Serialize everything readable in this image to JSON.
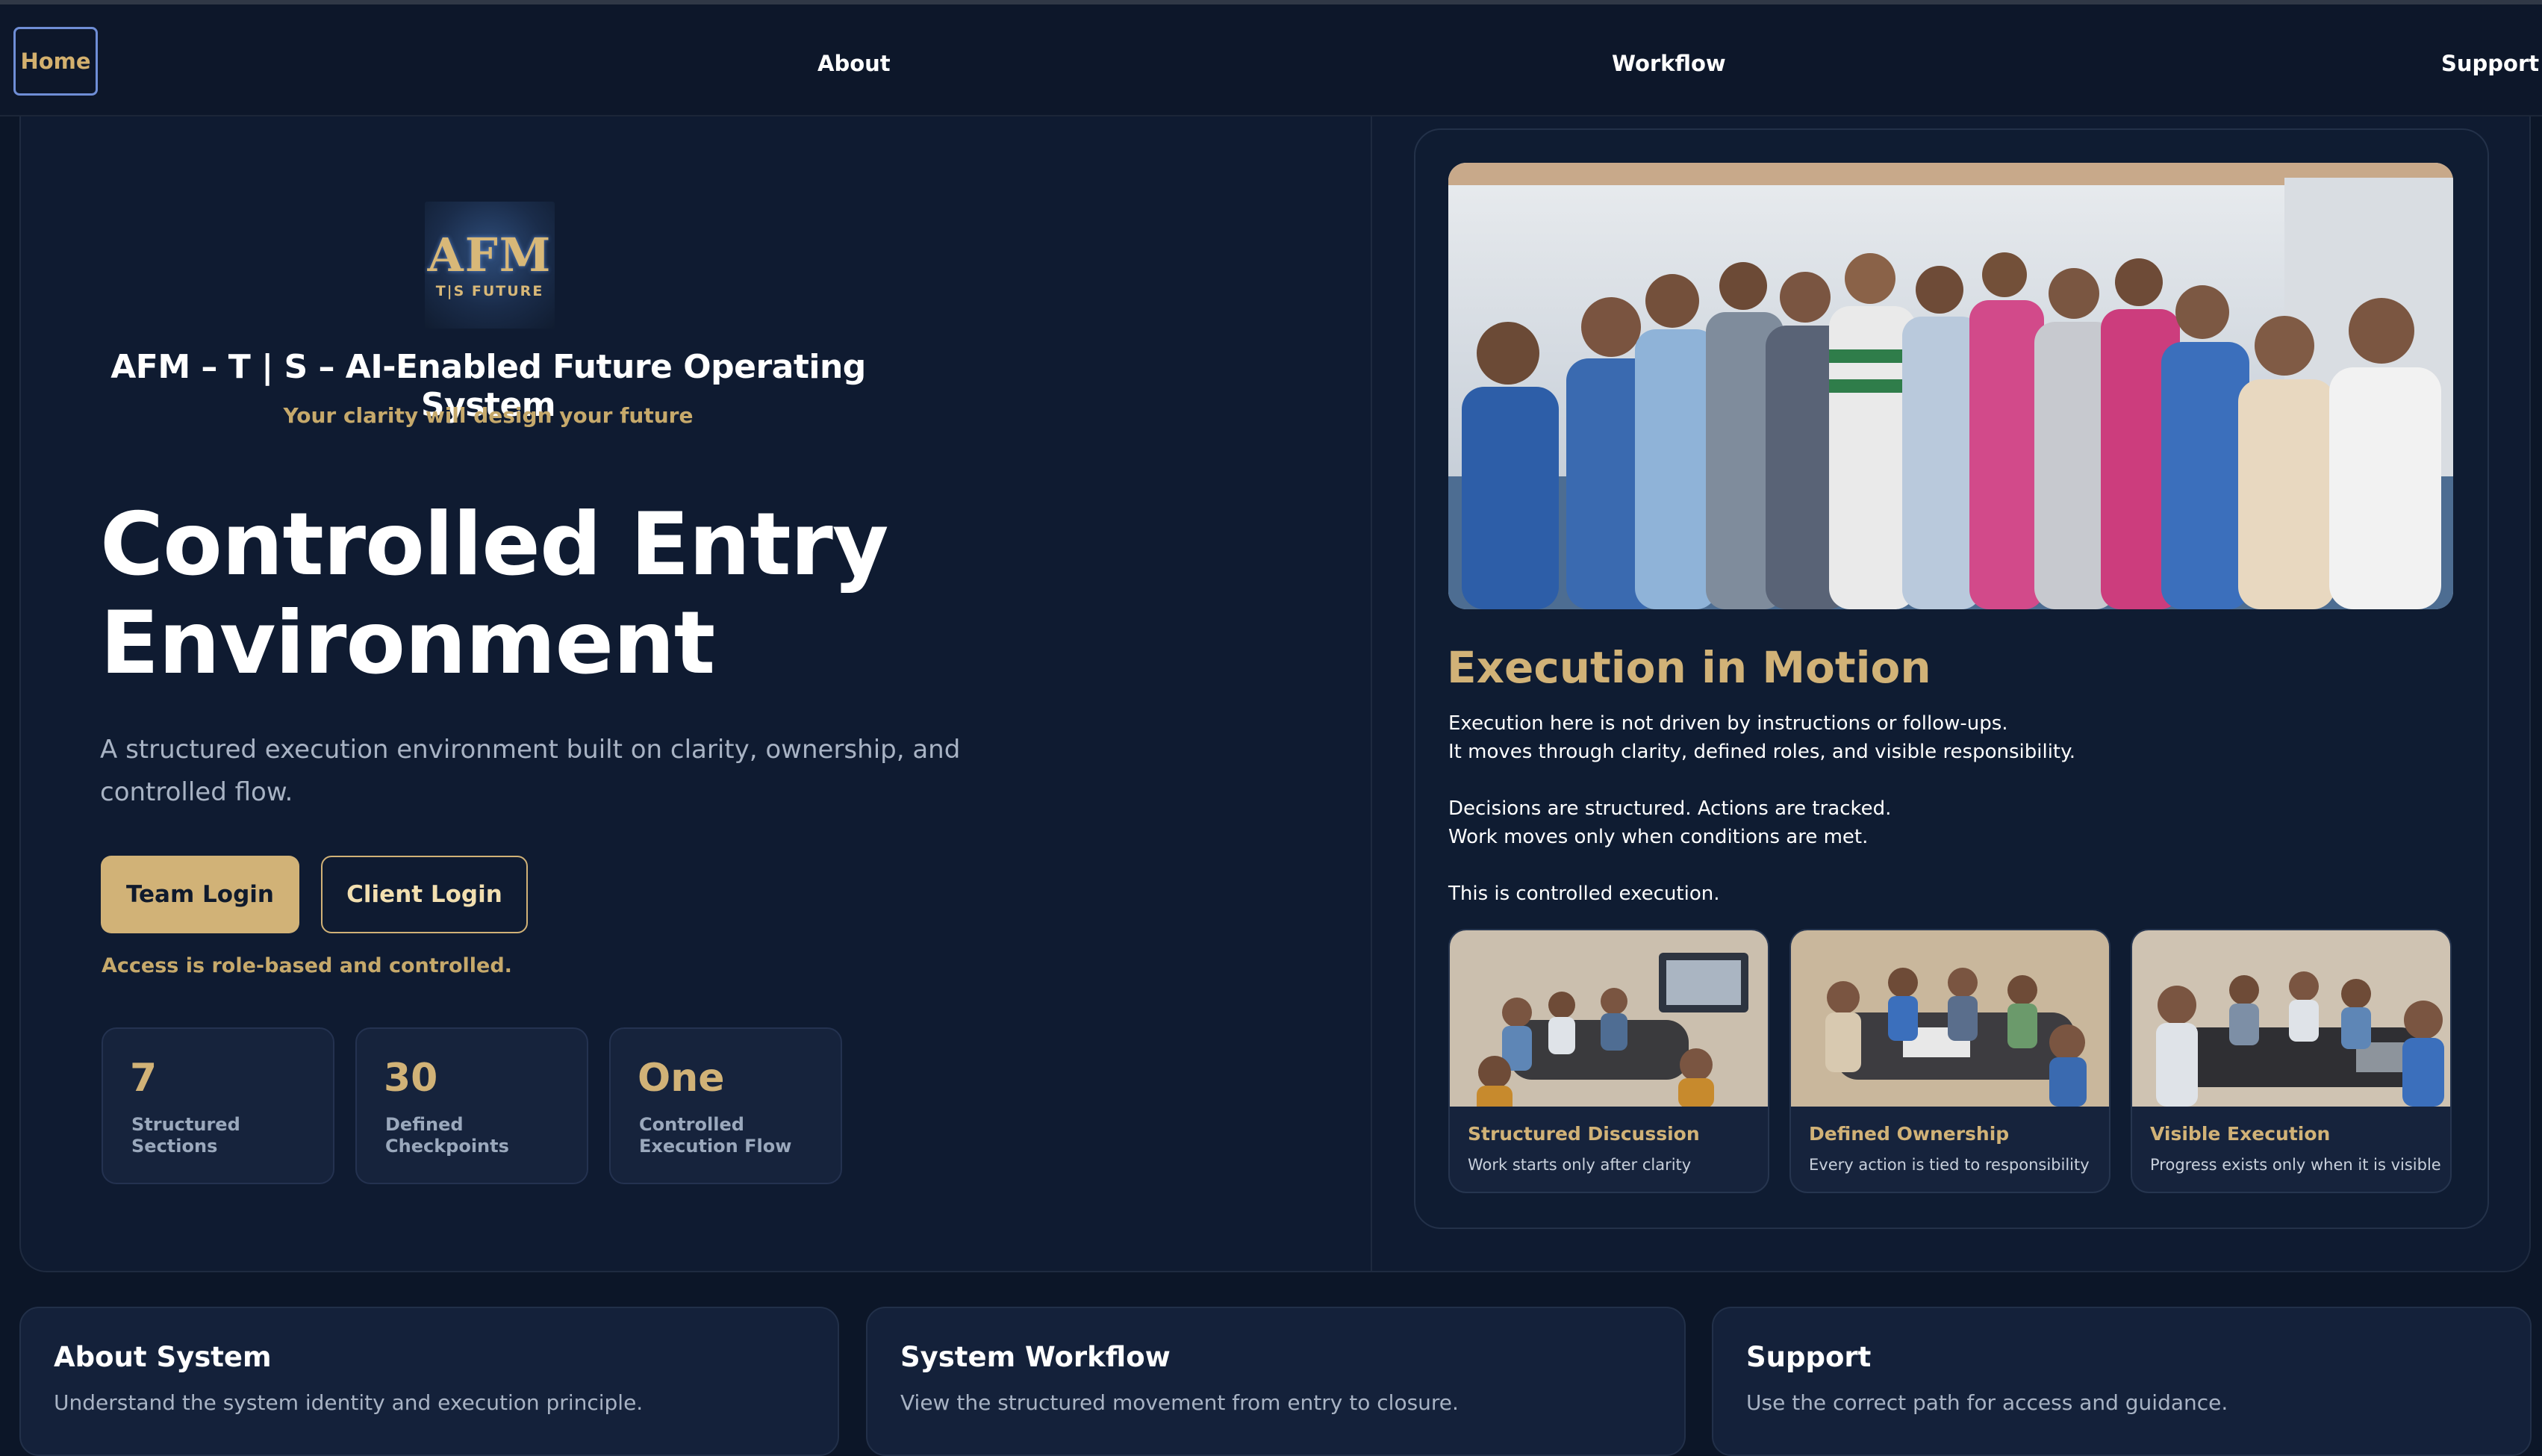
{
  "nav": {
    "home": "Home",
    "about": "About",
    "workflow": "Workflow",
    "support": "Support"
  },
  "brand": {
    "logo_main": "AFM",
    "logo_sub": "T|S FUTURE",
    "title": "AFM – T | S – AI-Enabled Future Operating System",
    "tagline": "Your clarity will design your future"
  },
  "hero": {
    "heading_line1": "Controlled Entry",
    "heading_line2": "Environment",
    "description": "A structured execution environment built on clarity, ownership, and controlled flow.",
    "team_login": "Team Login",
    "client_login": "Client Login",
    "access_note": "Access is role-based and controlled."
  },
  "stats": [
    {
      "value": "7",
      "label_line1": "Structured",
      "label_line2": "Sections"
    },
    {
      "value": "30",
      "label_line1": "Defined",
      "label_line2": "Checkpoints"
    },
    {
      "value": "One",
      "label_line1": "Controlled",
      "label_line2": "Execution Flow"
    }
  ],
  "execution": {
    "title": "Execution in Motion",
    "lines": [
      "Execution here is not driven by instructions or follow-ups.",
      "It moves through clarity, defined roles, and visible responsibility.",
      "Decisions are structured. Actions are tracked.",
      "Work moves only when conditions are met.",
      "This is controlled execution."
    ],
    "cards": [
      {
        "title": "Structured Discussion",
        "subtitle": "Work starts only after clarity"
      },
      {
        "title": "Defined Ownership",
        "subtitle": "Every action is tied to responsibility"
      },
      {
        "title": "Visible Execution",
        "subtitle": "Progress exists only when it is visible"
      }
    ]
  },
  "bottom_cards": [
    {
      "title": "About System",
      "description": "Understand the system identity and execution principle."
    },
    {
      "title": "System Workflow",
      "description": "View the structured movement from entry to closure."
    },
    {
      "title": "Support",
      "description": "Use the correct path for access and guidance."
    }
  ],
  "colors": {
    "background": "#0c1628",
    "accent_gold": "#d1b277",
    "card": "#16233c",
    "nav_focus": "#6f8ed6"
  }
}
